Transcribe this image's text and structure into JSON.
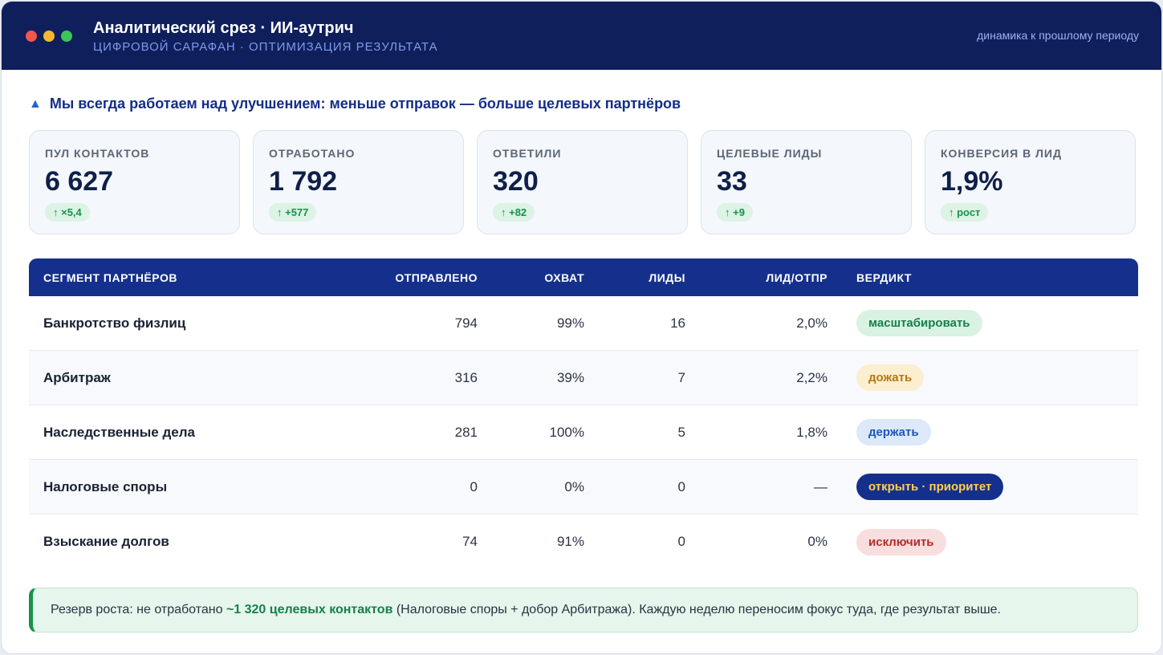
{
  "window": {
    "title": "Аналитический срез · ИИ-аутрич",
    "subtitle": "ЦИФРОВОЙ САРАФАН · ОПТИМИЗАЦИЯ РЕЗУЛЬТАТА",
    "period_label": "динамика к прошлому периоду"
  },
  "headline": "Мы всегда работаем над улучшением: меньше отправок — больше целевых партнёров",
  "kpis": [
    {
      "label": "ПУЛ КОНТАКТОВ",
      "value": "6 627",
      "delta": "↑ ×5,4"
    },
    {
      "label": "ОТРАБОТАНО",
      "value": "1 792",
      "delta": "↑ +577"
    },
    {
      "label": "ОТВЕТИЛИ",
      "value": "320",
      "delta": "↑ +82"
    },
    {
      "label": "ЦЕЛЕВЫЕ ЛИДЫ",
      "value": "33",
      "delta": "↑ +9"
    },
    {
      "label": "КОНВЕРСИЯ В ЛИД",
      "value": "1,9%",
      "delta": "↑ рост"
    }
  ],
  "table": {
    "headers": {
      "segment": "СЕГМЕНТ ПАРТНЁРОВ",
      "sent": "ОТПРАВЛЕНО",
      "reach": "ОХВАТ",
      "leads": "ЛИДЫ",
      "ratio": "ЛИД/ОТПР",
      "verdict": "ВЕРДИКТ"
    },
    "rows": [
      {
        "segment": "Банкротство физлиц",
        "sent": "794",
        "reach": "99%",
        "leads": "16",
        "ratio": "2,0%",
        "verdict": "масштабировать"
      },
      {
        "segment": "Арбитраж",
        "sent": "316",
        "reach": "39%",
        "leads": "7",
        "ratio": "2,2%",
        "verdict": "дожать"
      },
      {
        "segment": "Наследственные дела",
        "sent": "281",
        "reach": "100%",
        "leads": "5",
        "ratio": "1,8%",
        "verdict": "держать"
      },
      {
        "segment": "Налоговые споры",
        "sent": "0",
        "reach": "0%",
        "leads": "0",
        "ratio": "—",
        "verdict": "открыть · приоритет"
      },
      {
        "segment": "Взыскание долгов",
        "sent": "74",
        "reach": "91%",
        "leads": "0",
        "ratio": "0%",
        "verdict": "исключить"
      }
    ]
  },
  "note": {
    "prefix": "Резерв роста: не отработано ",
    "highlight": "~1 320 целевых контактов",
    "suffix": " (Налоговые споры + добор Арбитража). Каждую неделю переносим фокус туда, где результат выше."
  },
  "colors": {
    "header_bg": "#0f1f5c",
    "table_header_bg": "#15308c",
    "positive": "#17924b"
  }
}
